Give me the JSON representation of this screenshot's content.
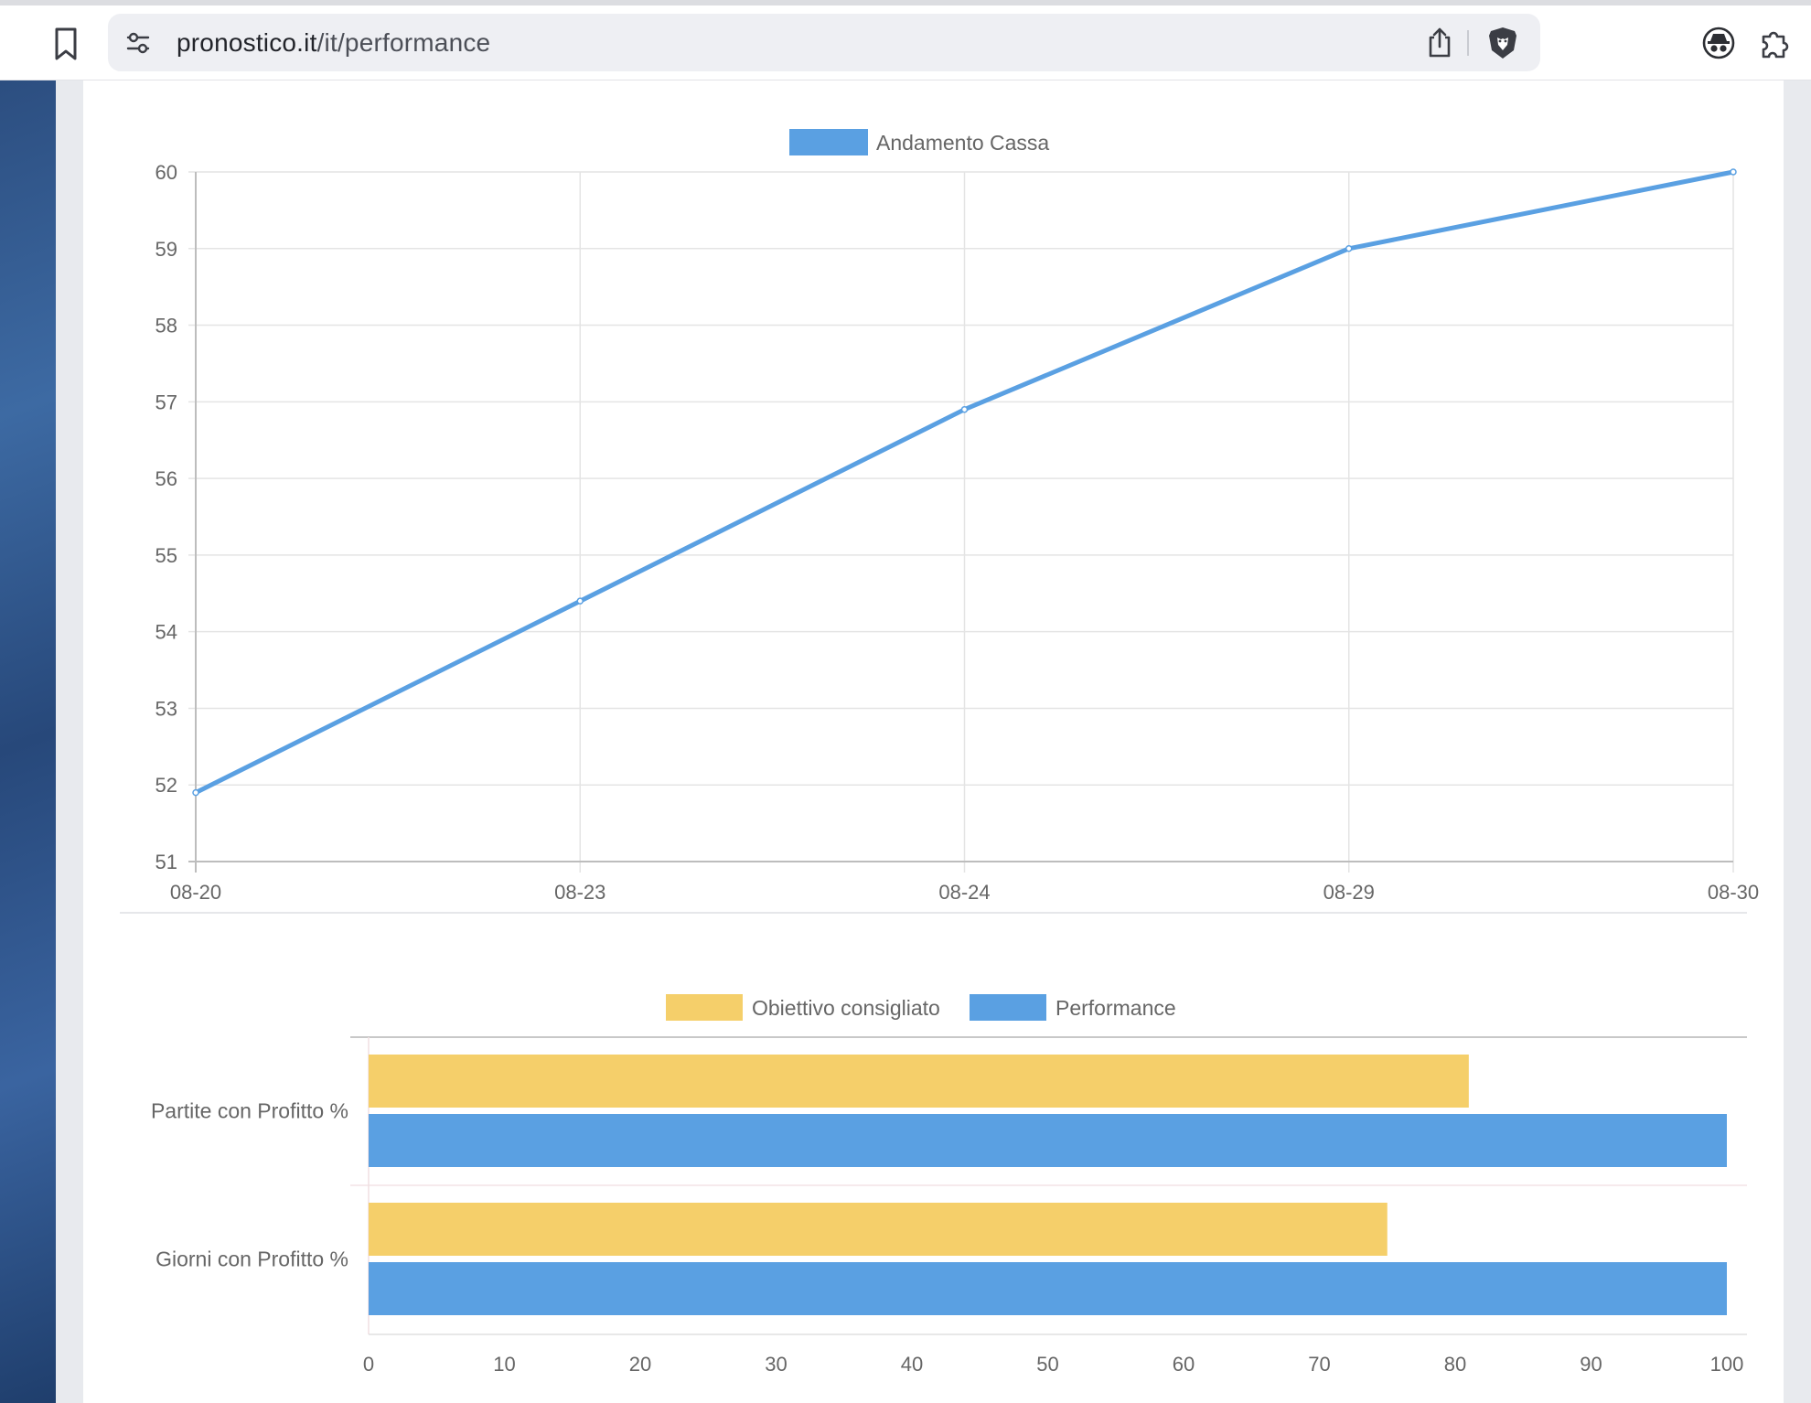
{
  "browser": {
    "url_domain": "pronostico.it",
    "url_path": "/it/performance"
  },
  "line_chart": {
    "legend_label": "Andamento Cassa",
    "color": "#5aa0e2"
  },
  "bar_chart": {
    "legend": [
      {
        "label": "Obiettivo consigliato",
        "color": "#f5cf6a"
      },
      {
        "label": "Performance",
        "color": "#5aa0e2"
      }
    ]
  },
  "chart_data": [
    {
      "type": "line",
      "categories": [
        "08-20",
        "08-23",
        "08-24",
        "08-29",
        "08-30"
      ],
      "series": [
        {
          "name": "Andamento Cassa",
          "values": [
            51.9,
            54.4,
            56.9,
            59.0,
            60.0
          ],
          "color": "#5aa0e2"
        }
      ],
      "ylim": [
        51,
        60
      ],
      "yticks": [
        "51",
        "52",
        "53",
        "54",
        "55",
        "56",
        "57",
        "58",
        "59",
        "60"
      ],
      "grid": true,
      "legend_position": "top"
    },
    {
      "type": "bar",
      "orientation": "horizontal",
      "categories": [
        "Partite con Profitto %",
        "Giorni con Profitto %"
      ],
      "series": [
        {
          "name": "Obiettivo consigliato",
          "values": [
            81,
            75
          ],
          "color": "#f5cf6a"
        },
        {
          "name": "Performance",
          "values": [
            100,
            100
          ],
          "color": "#5aa0e2"
        }
      ],
      "xlim": [
        0,
        100
      ],
      "xticks": [
        "0",
        "10",
        "20",
        "30",
        "40",
        "50",
        "60",
        "70",
        "80",
        "90",
        "100"
      ],
      "legend_position": "top"
    }
  ]
}
